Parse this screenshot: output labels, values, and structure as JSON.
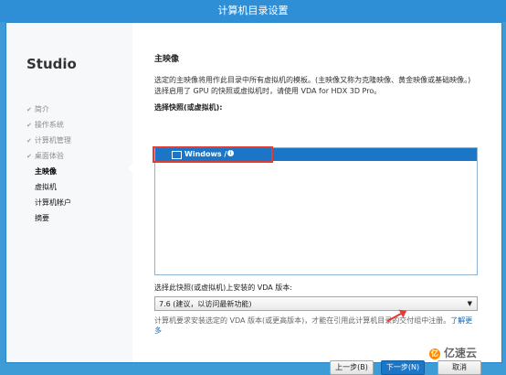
{
  "window": {
    "title": "计算机目录设置"
  },
  "sidebar": {
    "product": "Studio",
    "items": [
      {
        "label": "简介",
        "state": "done"
      },
      {
        "label": "操作系统",
        "state": "done"
      },
      {
        "label": "计算机管理",
        "state": "done"
      },
      {
        "label": "桌面体验",
        "state": "done"
      },
      {
        "label": "主映像",
        "state": "current"
      },
      {
        "label": "虚拟机",
        "state": "pending"
      },
      {
        "label": "计算机帐户",
        "state": "pending"
      },
      {
        "label": "摘要",
        "state": "pending"
      }
    ]
  },
  "main": {
    "heading": "主映像",
    "desc1": "选定的主映像将用作此目录中所有虚拟机的模板。(主映像又称为克隆映像、黄金映像或基础映像。)",
    "desc2": "选择启用了 GPU 的快照或虚拟机时，请使用 VDA for HDX 3D Pro。",
    "select_label": "选择快照(或虚拟机):",
    "snapshot_item": "Windows /",
    "vda_label": "选择此快照(或虚拟机)上安装的 VDA 版本:",
    "vda_value": "7.6 (建议，以访问最新功能)",
    "note": "计算机要求安装选定的 VDA 版本(或更高版本)，才能在引用此计算机目录的交付组中注册。",
    "note_link": "了解更多"
  },
  "buttons": {
    "back": "上一步(B)",
    "next": "下一步(N)",
    "cancel": "取消"
  },
  "watermark": {
    "brand": "亿速云"
  }
}
